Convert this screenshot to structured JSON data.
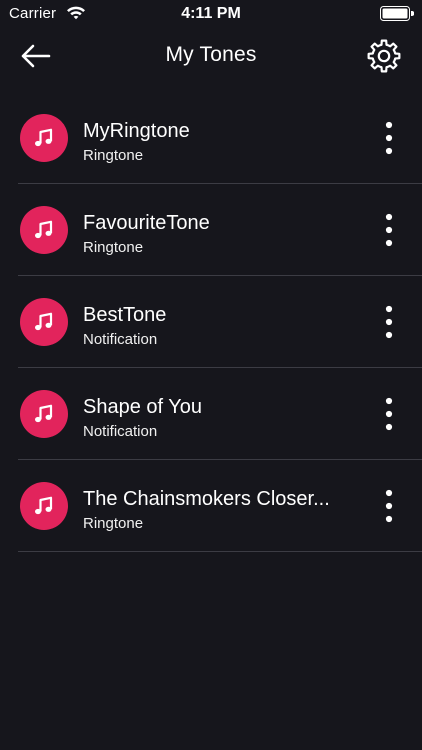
{
  "status_bar": {
    "carrier": "Carrier",
    "time": "4:11 PM",
    "wifi_icon": "wifi-icon",
    "battery_icon": "battery-icon"
  },
  "nav": {
    "title": "My Tones",
    "back_icon": "arrow-left-icon",
    "settings_icon": "gear-icon"
  },
  "accent_color": "#e2245c",
  "background_color": "#16161c",
  "tones": [
    {
      "title": "MyRingtone",
      "type": "Ringtone",
      "icon": "music-note-icon",
      "menu_icon": "more-vertical-icon"
    },
    {
      "title": "FavouriteTone",
      "type": "Ringtone",
      "icon": "music-note-icon",
      "menu_icon": "more-vertical-icon"
    },
    {
      "title": "BestTone",
      "type": "Notification",
      "icon": "music-note-icon",
      "menu_icon": "more-vertical-icon"
    },
    {
      "title": "Shape of You",
      "type": "Notification",
      "icon": "music-note-icon",
      "menu_icon": "more-vertical-icon"
    },
    {
      "title": "The Chainsmokers Closer...",
      "type": "Ringtone",
      "icon": "music-note-icon",
      "menu_icon": "more-vertical-icon"
    }
  ]
}
